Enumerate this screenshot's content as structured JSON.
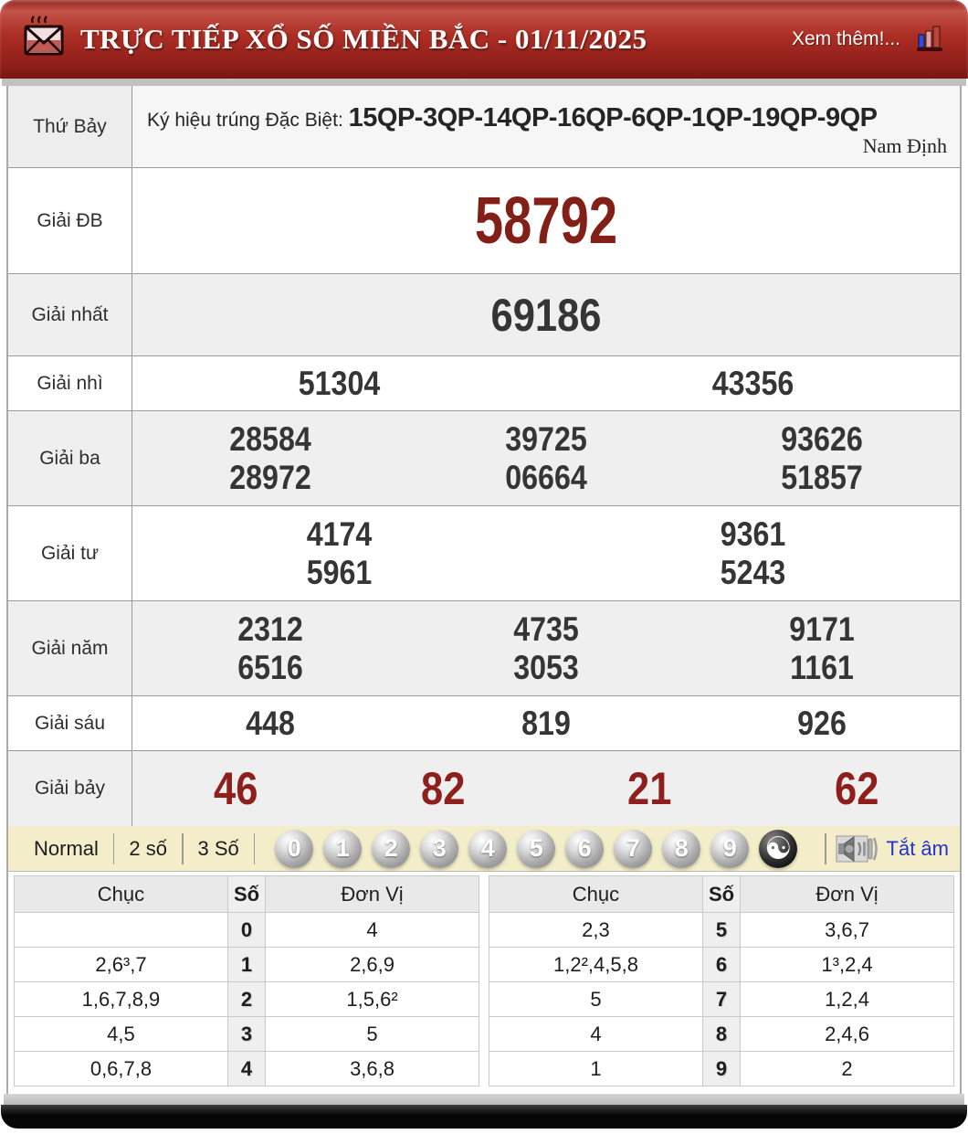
{
  "header": {
    "title": "TRỰC TIẾP XỔ SỐ MIỀN BẮC - 01/11/2025",
    "more_label": "Xem thêm!..."
  },
  "info_row": {
    "day": "Thứ Bảy",
    "sign_label": "Ký hiệu trúng Đặc Biệt:",
    "sign_codes": "15QP-3QP-14QP-16QP-6QP-1QP-19QP-9QP",
    "province": "Nam Định"
  },
  "prizes": [
    {
      "label": "Giải ĐB",
      "rows": [
        [
          "58792"
        ]
      ]
    },
    {
      "label": "Giải nhất",
      "rows": [
        [
          "69186"
        ]
      ]
    },
    {
      "label": "Giải nhì",
      "rows": [
        [
          "51304",
          "43356"
        ]
      ]
    },
    {
      "label": "Giải ba",
      "rows": [
        [
          "28584",
          "39725",
          "93626"
        ],
        [
          "28972",
          "06664",
          "51857"
        ]
      ]
    },
    {
      "label": "Giải tư",
      "rows": [
        [
          "4174",
          "9361"
        ],
        [
          "5961",
          "5243"
        ]
      ]
    },
    {
      "label": "Giải năm",
      "rows": [
        [
          "2312",
          "4735",
          "9171"
        ],
        [
          "6516",
          "3053",
          "1161"
        ]
      ]
    },
    {
      "label": "Giải sáu",
      "rows": [
        [
          "448",
          "819",
          "926"
        ]
      ]
    },
    {
      "label": "Giải bảy",
      "rows": [
        [
          "46",
          "82",
          "21",
          "62"
        ]
      ]
    }
  ],
  "controls": {
    "modes": [
      "Normal",
      "2 số",
      "3 Số"
    ],
    "balls": [
      "0",
      "1",
      "2",
      "3",
      "4",
      "5",
      "6",
      "7",
      "8",
      "9"
    ],
    "yinyang": "☯",
    "mute_label": "Tắt âm"
  },
  "summary_table": {
    "headers": [
      "Chục",
      "Số",
      "Đơn Vị"
    ],
    "left": [
      {
        "chuc": "",
        "so": "0",
        "donvi": "4"
      },
      {
        "chuc": "2,6³,7",
        "so": "1",
        "donvi": "2,6,9"
      },
      {
        "chuc": "1,6,7,8,9",
        "so": "2",
        "donvi": "1,5,6²"
      },
      {
        "chuc": "4,5",
        "so": "3",
        "donvi": "5"
      },
      {
        "chuc": "0,6,7,8",
        "so": "4",
        "donvi": "3,6,8"
      }
    ],
    "right": [
      {
        "chuc": "2,3",
        "so": "5",
        "donvi": "3,6,7"
      },
      {
        "chuc": "1,2²,4,5,8",
        "so": "6",
        "donvi": "1³,2,4"
      },
      {
        "chuc": "5",
        "so": "7",
        "donvi": "1,2,4"
      },
      {
        "chuc": "4",
        "so": "8",
        "donvi": "2,4,6"
      },
      {
        "chuc": "1",
        "so": "9",
        "donvi": "2"
      }
    ]
  },
  "colors": {
    "header_red": "#ac2e24",
    "prize_special_red": "#822018",
    "prize_seven_red": "#8e1f1c",
    "control_bar_cream": "#f3edc9",
    "mute_link_blue": "#2433cc",
    "number_dark": "#353535"
  }
}
